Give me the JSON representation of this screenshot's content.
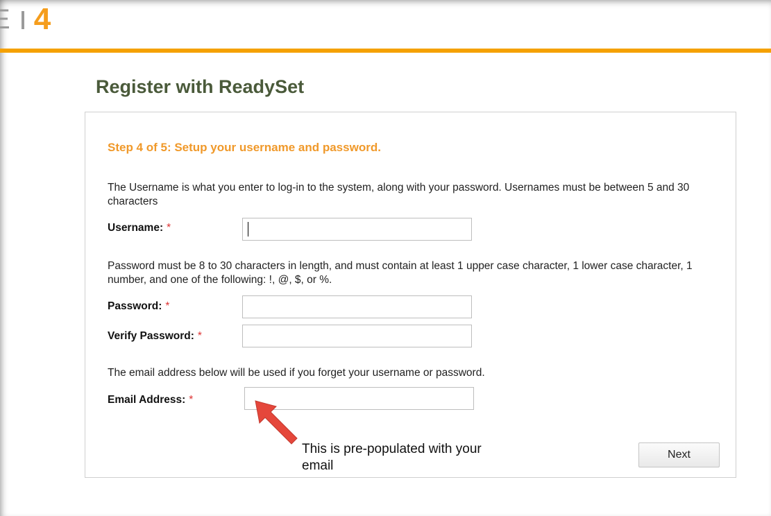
{
  "brand": {
    "logo_letter": "E",
    "logo_number": "4",
    "accent_color": "#f5a100"
  },
  "page": {
    "title": "Register with ReadySet"
  },
  "step": {
    "title": "Step 4 of 5: Setup your username and password."
  },
  "username": {
    "help": "The Username is what you enter to log-in to the system, along with your password. Usernames must be between 5 and 30 characters",
    "label": "Username:",
    "required_marker": "*",
    "value": ""
  },
  "password": {
    "help": "Password must be 8 to 30 characters in length, and must contain at least 1 upper case character, 1 lower case character, 1 number, and one of the following: !, @, $, or %.",
    "label": "Password:",
    "required_marker": "*",
    "value": ""
  },
  "verify_password": {
    "label": "Verify Password:",
    "required_marker": "*",
    "value": ""
  },
  "email": {
    "help": "The email address below will be used if you forget your username or password.",
    "label": "Email Address:",
    "required_marker": "*",
    "value": ""
  },
  "next_button": {
    "label": "Next"
  },
  "annotation": {
    "text": "This is pre-populated with your email",
    "arrow_color": "#e5473b"
  }
}
